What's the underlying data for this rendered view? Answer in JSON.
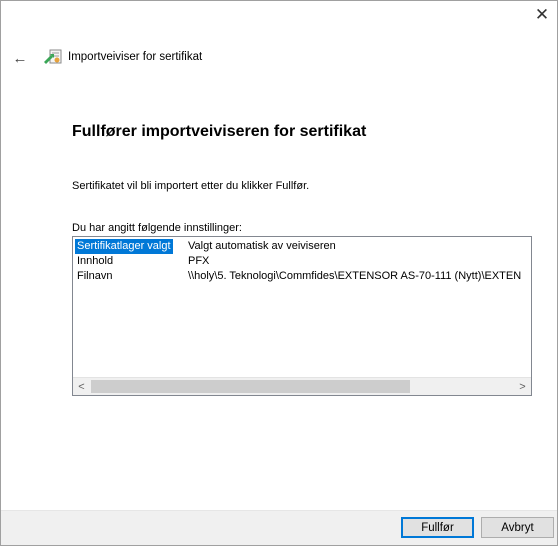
{
  "window": {
    "close_label": "✕",
    "back_label": "←",
    "title": "Importveiviser for sertifikat",
    "icon": "certificate-wizard-icon"
  },
  "main": {
    "heading": "Fullfører importveiviseren for sertifikat",
    "info": "Sertifikatet vil bli importert etter du klikker Fullfør.",
    "settings_label": "Du har angitt følgende innstillinger:"
  },
  "settings": {
    "rows": [
      {
        "key": "Sertifikatlager valgt",
        "value": "Valgt automatisk av veiviseren",
        "selected": true
      },
      {
        "key": "Innhold",
        "value": "PFX"
      },
      {
        "key": "Filnavn",
        "value": "\\\\holy\\5. Teknologi\\Commfides\\EXTENSOR AS-70-111 (Nytt)\\EXTEN"
      }
    ]
  },
  "scrollbar": {
    "left_arrow": "<",
    "right_arrow": ">"
  },
  "footer": {
    "finish_label": "Fullfør",
    "cancel_label": "Avbryt"
  },
  "colors": {
    "accent": "#0078d7",
    "footer_bg": "#f0f0f0"
  }
}
